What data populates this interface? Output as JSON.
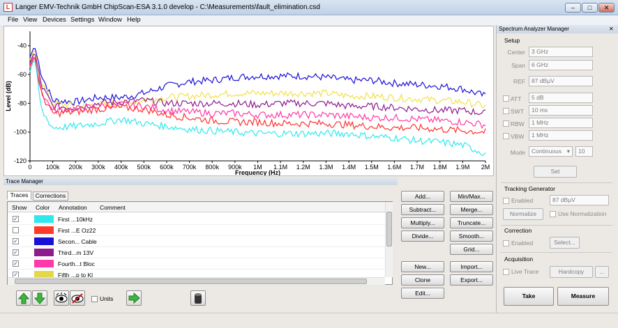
{
  "window": {
    "title": "Langer EMV-Technik GmbH ChipScan-ESA 3.1.0 develop  - C:\\Measurements\\fault_elimination.csd"
  },
  "menu": [
    "File",
    "View",
    "Devices",
    "Settings",
    "Window",
    "Help"
  ],
  "chart_data": {
    "type": "line",
    "xlabel": "Frequency (Hz)",
    "ylabel": "Level (dB)",
    "xlim": [
      0,
      2000000
    ],
    "ylim": [
      -120,
      -30
    ],
    "x_ticks": [
      "0",
      "100k",
      "200k",
      "300k",
      "400k",
      "500k",
      "600k",
      "700k",
      "800k",
      "900k",
      "1M",
      "1.1M",
      "1.2M",
      "1.3M",
      "1.4M",
      "1.5M",
      "1.6M",
      "1.7M",
      "1.8M",
      "1.9M",
      "2M"
    ],
    "y_ticks": [
      "-40",
      "-60",
      "-80",
      "-100",
      "-120"
    ],
    "grid": false,
    "x": [
      0,
      20000,
      50000,
      100000,
      200000,
      300000,
      400000,
      500000,
      600000,
      700000,
      800000,
      900000,
      1000000,
      1100000,
      1200000,
      1300000,
      1400000,
      1500000,
      1600000,
      1700000,
      1800000,
      1900000,
      2000000
    ],
    "series": [
      {
        "color": "#1a10d8",
        "values": [
          -48,
          -40,
          -60,
          -78,
          -79,
          -76,
          -76,
          -73,
          -68,
          -65,
          -64,
          -62,
          -61,
          -61,
          -61,
          -62,
          -64,
          -64,
          -66,
          -67,
          -68,
          -70,
          -75
        ]
      },
      {
        "color": "#f2e04a",
        "values": [
          -50,
          -42,
          -65,
          -80,
          -82,
          -81,
          -80,
          -78,
          -76,
          -75,
          -74,
          -73,
          -73,
          -73,
          -73,
          -73,
          -75,
          -75,
          -76,
          -77,
          -78,
          -79,
          -82
        ]
      },
      {
        "color": "#8e1a8e",
        "values": [
          -52,
          -44,
          -68,
          -82,
          -83,
          -80,
          -79,
          -78,
          -80,
          -80,
          -80,
          -80,
          -81,
          -80,
          -80,
          -80,
          -82,
          -82,
          -83,
          -84,
          -85,
          -85,
          -87
        ]
      },
      {
        "color": "#ff3aa8",
        "values": [
          -54,
          -46,
          -72,
          -85,
          -84,
          -82,
          -81,
          -82,
          -85,
          -86,
          -87,
          -87,
          -88,
          -88,
          -88,
          -88,
          -89,
          -90,
          -90,
          -91,
          -92,
          -93,
          -95
        ]
      },
      {
        "color": "#ff3030",
        "values": [
          -55,
          -47,
          -74,
          -87,
          -86,
          -84,
          -83,
          -84,
          -88,
          -90,
          -92,
          -93,
          -93,
          -94,
          -94,
          -94,
          -95,
          -96,
          -97,
          -97,
          -98,
          -99,
          -100
        ]
      },
      {
        "color": "#2fe8ee",
        "values": [
          -58,
          -48,
          -85,
          -97,
          -96,
          -94,
          -91,
          -94,
          -96,
          -98,
          -99,
          -100,
          -101,
          -101,
          -101,
          -101,
          -101,
          -103,
          -104,
          -106,
          -107,
          -109,
          -115
        ]
      }
    ]
  },
  "trace_manager": {
    "title": "Trace Manager",
    "tabs": [
      "Traces",
      "Corrections"
    ],
    "columns": [
      "Show",
      "Color",
      "Annotation",
      "Comment"
    ],
    "rows": [
      {
        "show": true,
        "check": "✓",
        "color": "#2fe8ee",
        "annotation": "First ...10kHz",
        "comment": ""
      },
      {
        "show": false,
        "check": "",
        "color": "#ff3a2a",
        "annotation": "First ...E Oz22",
        "comment": ""
      },
      {
        "show": true,
        "check": "✓",
        "color": "#1a10d8",
        "annotation": "Secon... Cable",
        "comment": ""
      },
      {
        "show": true,
        "check": "✓",
        "color": "#8e1a8e",
        "annotation": "Third...m 13V",
        "comment": ""
      },
      {
        "show": true,
        "check": "✓",
        "color": "#ff3aa8",
        "annotation": "Fourth...t Bloc",
        "comment": ""
      },
      {
        "show": true,
        "check": "✓",
        "color": "#e2d84a",
        "annotation": "Fifth ...p to Kl",
        "comment": ""
      }
    ],
    "buttons_col1": [
      "Add...",
      "Subtract...",
      "Multiply...",
      "Divide...",
      "New...",
      "Clone",
      "Edit..."
    ],
    "buttons_col2": [
      "Min/Max...",
      "Merge...",
      "Truncate...",
      "Smooth...",
      "Grid...",
      "Import...",
      "Export..."
    ],
    "units_label": "Units"
  },
  "sam": {
    "title": "Spectrum Analyzer Manager",
    "setup": "Setup",
    "center_label": "Center",
    "center": "3 GHz",
    "span_label": "Span",
    "span": "6 GHz",
    "ref_label": "REF",
    "ref": "87 dBµV",
    "att_label": "ATT",
    "att": "5 dB",
    "swt_label": "SWT",
    "swt": "10 ms",
    "rbw_label": "RBW",
    "rbw": "1 MHz",
    "vbw_label": "VBW",
    "vbw": "1 MHz",
    "mode_label": "Mode",
    "mode": "Continuous",
    "mode_count": "10",
    "set": "Set",
    "tracking_generator": "Tracking Generator",
    "enabled": "Enabled",
    "tg_level": "87 dBµV",
    "normalize": "Normalize",
    "use_normalization": "Use Normalization",
    "correction": "Correction",
    "corr_enabled": "Enabled",
    "select": "Select...",
    "acquisition": "Acquisition",
    "live_trace": "Live Trace",
    "hardcopy": "Hardcopy",
    "more": "...",
    "take": "Take",
    "measure": "Measure"
  },
  "colors": {
    "accent": "#3a7bd5",
    "green": "#3fb43f"
  }
}
